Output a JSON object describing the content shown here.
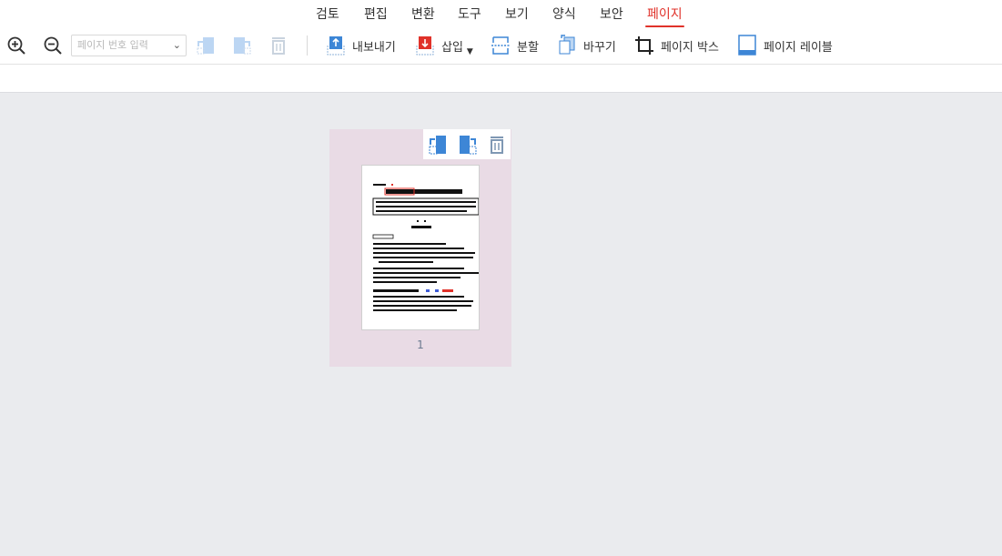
{
  "menu": {
    "tabs": [
      {
        "label": "검토"
      },
      {
        "label": "편집"
      },
      {
        "label": "변환"
      },
      {
        "label": "도구"
      },
      {
        "label": "보기"
      },
      {
        "label": "양식"
      },
      {
        "label": "보안"
      },
      {
        "label": "페이지"
      }
    ],
    "active_tab": "페이지"
  },
  "toolbar": {
    "zoom_in_icon": "zoom-in-icon",
    "zoom_out_icon": "zoom-out-icon",
    "page_input_placeholder": "페이지 번호 입력",
    "export_label": "내보내기",
    "insert_label": "삽입",
    "split_label": "분할",
    "replace_label": "바꾸기",
    "page_box_label": "페이지 박스",
    "page_label_label": "페이지 레이블"
  },
  "thumbnails": [
    {
      "page_number": "1"
    }
  ],
  "colors": {
    "accent": "#e0322a",
    "icon_blue": "#3d86d6",
    "icon_red": "#e0322a",
    "workspace_bg": "#eaebee",
    "selected_card_bg": "#e9dbe5"
  }
}
